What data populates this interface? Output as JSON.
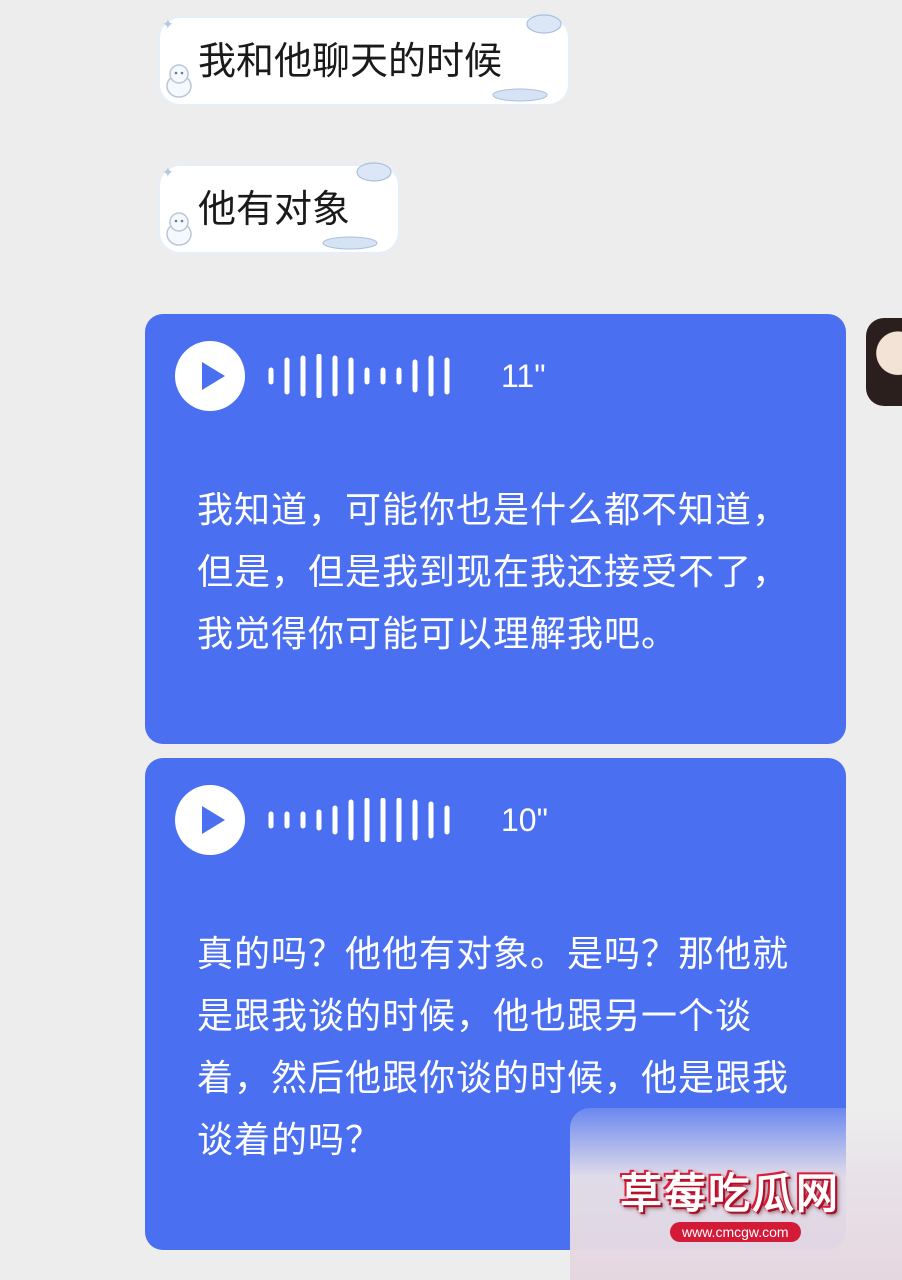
{
  "messages_incoming": [
    {
      "text": "我和他聊天的时候"
    },
    {
      "text": "他有对象"
    }
  ],
  "voice_messages": [
    {
      "duration": "11\"",
      "transcript": "我知道，可能你也是什么都不知道，但是，但是我到现在我还接受不了，我觉得你可能可以理解我吧。"
    },
    {
      "duration": "10\"",
      "transcript": "真的吗？他他有对象。是吗？那他就是跟我谈的时候，他也跟另一个谈着，然后他跟你谈的时候，他是跟我谈着的吗？"
    }
  ],
  "watermark": {
    "title": "草莓吃瓜网",
    "url": "www.cmcgw.com"
  },
  "colors": {
    "background": "#ededed",
    "voice_bubble": "#4a6ff0",
    "incoming_bubble": "#ffffff"
  }
}
